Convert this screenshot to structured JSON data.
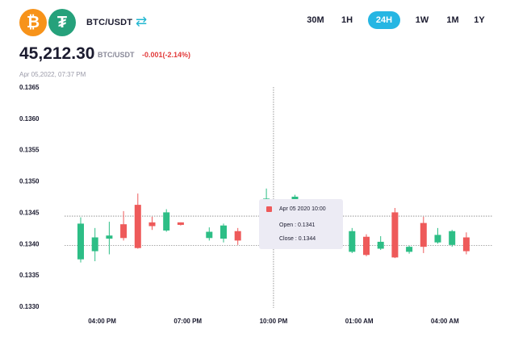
{
  "header": {
    "coin1_icon": "bitcoin-icon",
    "coin1_glyph": "₿",
    "coin2_icon": "tether-icon",
    "coin2_glyph": "₮",
    "pair": "BTC/USDT",
    "swap_icon": "swap-arrows-icon"
  },
  "timeframes": [
    {
      "label": "30M",
      "active": false
    },
    {
      "label": "1H",
      "active": false
    },
    {
      "label": "24H",
      "active": true
    },
    {
      "label": "1W",
      "active": false
    },
    {
      "label": "1M",
      "active": false
    },
    {
      "label": "1Y",
      "active": false
    }
  ],
  "summary": {
    "price": "45,212.30",
    "pair": "BTC/USDT",
    "change": "-0.001(-2.14%)",
    "date": "Apr 05,2022, 07:37 PM"
  },
  "colors": {
    "up": "#2dbe86",
    "down": "#ee5a5a",
    "accent": "#26b6e3"
  },
  "tooltip": {
    "date": "Apr 05 2020 10:00",
    "open": "Open : 0.1341",
    "close": "Close : 0.1344"
  },
  "chart_data": {
    "type": "candlestick",
    "ylim": [
      0.133,
      0.1365
    ],
    "yticks": [
      "0.1365",
      "0.1360",
      "0.1355",
      "0.1350",
      "0.1345",
      "0.1340",
      "0.1335",
      "0.1330"
    ],
    "xticks": [
      {
        "label": "04:00 PM",
        "index": 1.5
      },
      {
        "label": "07:00 PM",
        "index": 7.5
      },
      {
        "label": "10:00 PM",
        "index": 13.5
      },
      {
        "label": "01:00 AM",
        "index": 19.5
      },
      {
        "label": "04:00 AM",
        "index": 25.5
      }
    ],
    "crosshair": {
      "index": 13.5,
      "price": 0.13444
    },
    "reference_price": 0.13397,
    "candles": [
      {
        "i": 0,
        "o": 0.13375,
        "h": 0.13442,
        "l": 0.1337,
        "c": 0.13432
      },
      {
        "i": 1,
        "o": 0.13388,
        "h": 0.13425,
        "l": 0.13372,
        "c": 0.1341
      },
      {
        "i": 2,
        "o": 0.13408,
        "h": 0.13435,
        "l": 0.13383,
        "c": 0.13413
      },
      {
        "i": 3,
        "o": 0.13431,
        "h": 0.13452,
        "l": 0.13405,
        "c": 0.13409
      },
      {
        "i": 4,
        "o": 0.13462,
        "h": 0.1348,
        "l": 0.13392,
        "c": 0.13393
      },
      {
        "i": 5,
        "o": 0.13434,
        "h": 0.13443,
        "l": 0.13422,
        "c": 0.13428
      },
      {
        "i": 6,
        "o": 0.13421,
        "h": 0.13455,
        "l": 0.13419,
        "c": 0.1345
      },
      {
        "i": 7,
        "o": 0.13434,
        "h": 0.13434,
        "l": 0.13429,
        "c": 0.1343
      },
      {
        "i": 9,
        "o": 0.13409,
        "h": 0.13426,
        "l": 0.13405,
        "c": 0.13419
      },
      {
        "i": 10,
        "o": 0.13408,
        "h": 0.13432,
        "l": 0.13402,
        "c": 0.13429
      },
      {
        "i": 11,
        "o": 0.1342,
        "h": 0.13425,
        "l": 0.13398,
        "c": 0.13405
      },
      {
        "i": 13,
        "o": 0.13437,
        "h": 0.13488,
        "l": 0.13432,
        "c": 0.13472
      },
      {
        "i": 15,
        "o": 0.1347,
        "h": 0.13478,
        "l": 0.13465,
        "c": 0.13475
      },
      {
        "i": 19,
        "o": 0.13387,
        "h": 0.13425,
        "l": 0.13385,
        "c": 0.1342
      },
      {
        "i": 20,
        "o": 0.13411,
        "h": 0.13415,
        "l": 0.1338,
        "c": 0.13382
      },
      {
        "i": 21,
        "o": 0.13392,
        "h": 0.13412,
        "l": 0.1339,
        "c": 0.13403
      },
      {
        "i": 22,
        "o": 0.1345,
        "h": 0.13457,
        "l": 0.13377,
        "c": 0.13378
      },
      {
        "i": 23,
        "o": 0.13387,
        "h": 0.13397,
        "l": 0.13384,
        "c": 0.13395
      },
      {
        "i": 24,
        "o": 0.13433,
        "h": 0.13443,
        "l": 0.13385,
        "c": 0.13395
      },
      {
        "i": 25,
        "o": 0.13402,
        "h": 0.13425,
        "l": 0.134,
        "c": 0.13414
      },
      {
        "i": 26,
        "o": 0.13398,
        "h": 0.13422,
        "l": 0.13395,
        "c": 0.1342
      },
      {
        "i": 27,
        "o": 0.1341,
        "h": 0.13418,
        "l": 0.13383,
        "c": 0.13388
      }
    ]
  }
}
